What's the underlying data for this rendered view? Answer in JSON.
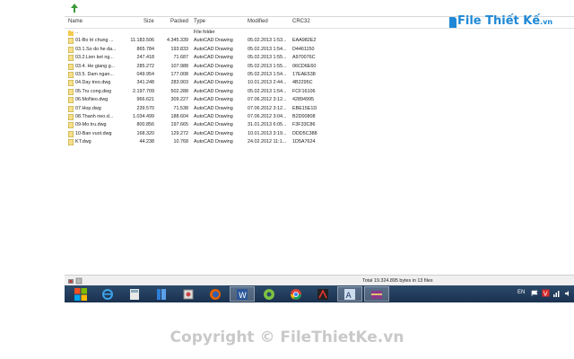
{
  "columns": {
    "name": "Name",
    "size": "Size",
    "packed": "Packed",
    "type": "Type",
    "modified": "Modified",
    "crc": "CRC32"
  },
  "files": [
    {
      "name": "..",
      "size": "",
      "packed": "",
      "type": "File folder",
      "modified": "",
      "crc": ""
    },
    {
      "name": "01-Bo tri chung ...",
      "size": "11.183.506",
      "packed": "4.345.339",
      "type": "AutoCAD Drawing",
      "modified": "05.02.2013 1:53...",
      "crc": "EAA982E2"
    },
    {
      "name": "03.1.So do he da...",
      "size": "865.784",
      "packed": "193.833",
      "type": "AutoCAD Drawing",
      "modified": "05.02.2013 1:54...",
      "crc": "D4461150"
    },
    {
      "name": "03.2.Lien ket ng...",
      "size": "247.418",
      "packed": "71.687",
      "type": "AutoCAD Drawing",
      "modified": "05.02.2013 1:55...",
      "crc": "A970076C"
    },
    {
      "name": "03.4. He giang g...",
      "size": "285.272",
      "packed": "107.988",
      "type": "AutoCAD Drawing",
      "modified": "05.02.2013 1:55...",
      "crc": "06CD6E60"
    },
    {
      "name": "03.5. Dam ngan...",
      "size": "049.954",
      "packed": "177.008",
      "type": "AutoCAD Drawing",
      "modified": "05.02.2013 1:54...",
      "crc": "17EAE538"
    },
    {
      "name": "04.Day treo.dwg",
      "size": "341.248",
      "packed": "283.903",
      "type": "AutoCAD Drawing",
      "modified": "10.01.2013 2:44...",
      "crc": "4B2295C"
    },
    {
      "name": "05.Tru cong.dwg",
      "size": "2.197.709",
      "packed": "502.288",
      "type": "AutoCAD Drawing",
      "modified": "05.02.2013 1:54...",
      "crc": "FCF16106"
    },
    {
      "name": "06.MoNeo.dwg",
      "size": "966.621",
      "packed": "309.227",
      "type": "AutoCAD Drawing",
      "modified": "07.06.2012 3:12...",
      "crc": "42894995"
    },
    {
      "name": "07.Hop.dwg",
      "size": "239.570",
      "packed": "71.538",
      "type": "AutoCAD Drawing",
      "modified": "07.06.2012 3:12...",
      "crc": "EBE15E1D"
    },
    {
      "name": "08.Thanh neo.d...",
      "size": "1.034.499",
      "packed": "188.604",
      "type": "AutoCAD Drawing",
      "modified": "07.06.2012 3:04...",
      "crc": "B2D00808"
    },
    {
      "name": "09-Mo tru.dwg",
      "size": "800.856",
      "packed": "197.665",
      "type": "AutoCAD Drawing",
      "modified": "31.01.2013 6:05...",
      "crc": "F3F33C86"
    },
    {
      "name": "10-Ban vuot.dwg",
      "size": "168.320",
      "packed": "129.272",
      "type": "AutoCAD Drawing",
      "modified": "10.01.2013 3:19...",
      "crc": "DDD5C388"
    },
    {
      "name": "KT.dwg",
      "size": "44.238",
      "packed": "10.768",
      "type": "AutoCAD Drawing",
      "modified": "24.02.2012 11:1...",
      "crc": "1D5A7624"
    }
  ],
  "status_text": "Total 19.324.895 bytes in 13 files",
  "taskbar_lang": "EN",
  "logo": {
    "main": "File Thiết Kế",
    "suffix": ".vn"
  },
  "watermark": "Copyright © FileThietKe.vn",
  "colors": {
    "taskbar": "#1f3a5c",
    "folder": "#f2c94c",
    "logo": "#1e88d6"
  },
  "taskbar_apps": [
    "start-orb",
    "internet-explorer-icon",
    "calculator-icon",
    "files-icon",
    "tool-icon",
    "firefox-icon",
    "word-icon",
    "browser-icon",
    "chrome-icon",
    "autocad-icon",
    "text-editor-icon",
    "winrar-icon"
  ]
}
